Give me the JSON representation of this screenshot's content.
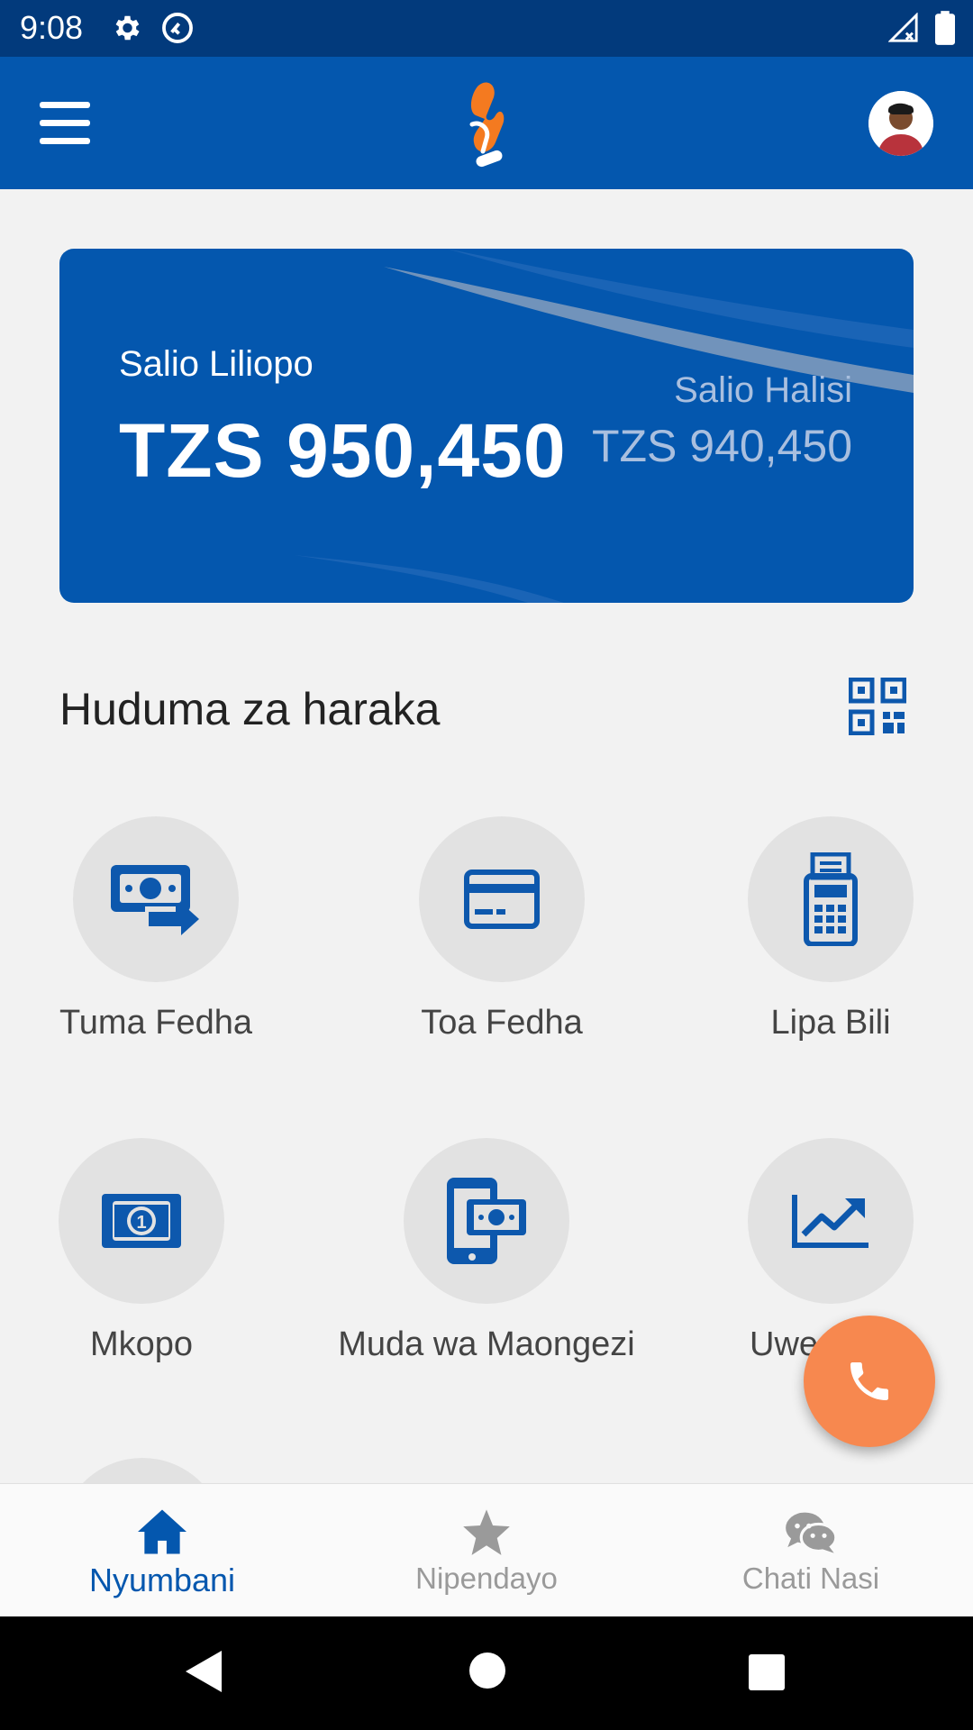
{
  "status_bar": {
    "time": "9:08",
    "icons": [
      "gear-icon",
      "cast-icon",
      "signal-icon",
      "battery-icon"
    ]
  },
  "app_bar": {
    "menu_icon": "hamburger-icon",
    "logo": "app-logo",
    "avatar": "user-avatar"
  },
  "balance": {
    "available_label": "Salio Liliopo",
    "available_value": "TZS 950,450",
    "actual_label": "Salio Halisi",
    "actual_value": "TZS 940,450"
  },
  "quick_services": {
    "title": "Huduma za haraka",
    "qr_icon": "qr-code-icon",
    "items": [
      {
        "label": "Tuma Fedha",
        "icon": "send-money-icon"
      },
      {
        "label": "Toa Fedha",
        "icon": "card-icon"
      },
      {
        "label": "Lipa Bili",
        "icon": "bill-calculator-icon"
      },
      {
        "label": "Mkopo",
        "icon": "banknote-icon"
      },
      {
        "label": "Muda wa Maongezi",
        "icon": "phone-money-icon"
      },
      {
        "label": "Uwe",
        "icon": "chart-trend-icon"
      }
    ]
  },
  "fab": {
    "icon": "phone-icon"
  },
  "bottom_nav": {
    "items": [
      {
        "label": "Nyumbani",
        "icon": "home-icon",
        "active": true
      },
      {
        "label": "Nipendayo",
        "icon": "star-icon",
        "active": false
      },
      {
        "label": "Chati Nasi",
        "icon": "chat-bubbles-icon",
        "active": false
      }
    ]
  },
  "colors": {
    "primary": "#0457ae",
    "status_bar": "#023a7c",
    "accent": "#f7884f",
    "icon_blue": "#0d58ad",
    "inactive": "#9a9a9a"
  }
}
